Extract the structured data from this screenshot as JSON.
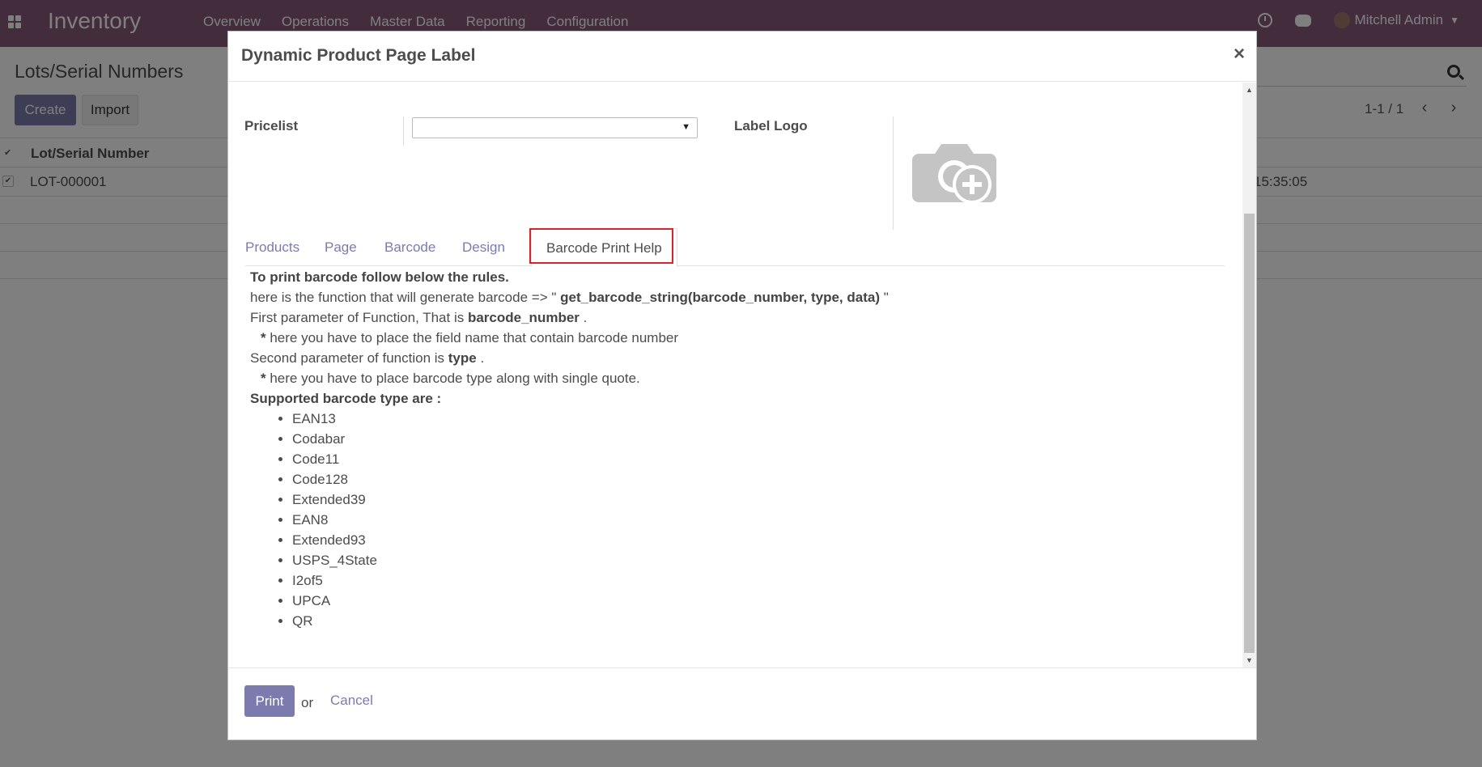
{
  "topbar": {
    "brand": "Inventory",
    "menu": [
      "Overview",
      "Operations",
      "Master Data",
      "Reporting",
      "Configuration"
    ],
    "user": "Mitchell Admin"
  },
  "control_panel": {
    "title": "Lots/Serial Numbers",
    "create_label": "Create",
    "import_label": "Import",
    "pager": "1-1 / 1"
  },
  "list": {
    "column": "Lot/Serial Number",
    "rows": [
      {
        "lot": "LOT-000001",
        "time": "15:35:05"
      }
    ]
  },
  "modal": {
    "title": "Dynamic Product Page Label",
    "close": "×",
    "pricelist_label": "Pricelist",
    "pricelist_value": "",
    "label_logo_label": "Label Logo",
    "tabs": [
      "Products",
      "Page",
      "Barcode",
      "Design",
      "Barcode Print Help"
    ],
    "active_tab": "Barcode Print Help",
    "help": {
      "heading": "To print barcode follow below the rules.",
      "line1_prefix": "here is the function that will generate barcode => \" ",
      "line1_func": "get_barcode_string(barcode_number, type, data)",
      "line1_suffix": " \"",
      "line2_prefix": "First parameter of Function, That is ",
      "line2_bold": "barcode_number",
      "line2_suffix": " .",
      "line3_star": "*",
      "line3_text": " here you have to place the field name that contain barcode number",
      "line4_prefix": "Second parameter of function is ",
      "line4_bold": "type",
      "line4_suffix": " .",
      "line5_star": "*",
      "line5_text": " here you have to place barcode type along with single quote.",
      "supported_heading": "Supported barcode type are :",
      "types": [
        "EAN13",
        "Codabar",
        "Code11",
        "Code128",
        "Extended39",
        "EAN8",
        "Extended93",
        "USPS_4State",
        "I2of5",
        "UPCA",
        "QR"
      ]
    },
    "footer": {
      "print_label": "Print",
      "or_text": "or",
      "cancel_label": "Cancel"
    }
  },
  "colors": {
    "topbar": "#875a7b",
    "primary": "#7c7bad",
    "highlight": "#d9252a"
  }
}
